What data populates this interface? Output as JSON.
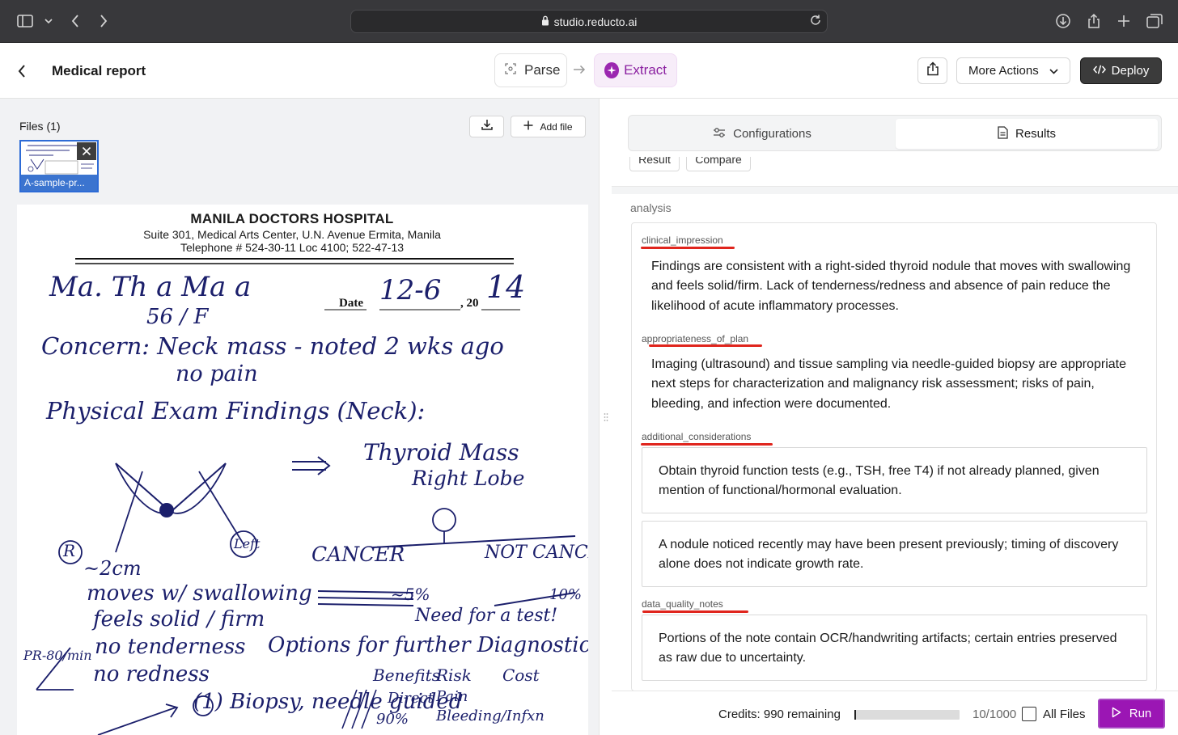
{
  "browser": {
    "url": "studio.reducto.ai"
  },
  "header": {
    "title": "Medical report",
    "steps": [
      "Parse",
      "Extract"
    ],
    "more_actions": "More Actions",
    "deploy": "Deploy"
  },
  "files": {
    "label": "Files (1)",
    "add_file": "Add file",
    "thumbnail_name": "A-sample-pr..."
  },
  "document": {
    "hospital_name": "MANILA DOCTORS HOSPITAL",
    "address": "Suite 301, Medical Arts Center, U.N. Avenue Ermita, Manila",
    "telephone": "Telephone # 524-30-11 Loc 4100; 522-47-13",
    "date_label": "Date",
    "date_year_prefix": ", 20",
    "handwriting": {
      "name": "Ma. Th   a Ma    a",
      "date": "12-6",
      "year": "14",
      "age_sex": "56 / F",
      "concern": "Concern: Neck mass - noted 2 wks ago",
      "no_pain": "no pain",
      "pe_heading": "Physical Exam Findings (Neck):",
      "thyroid": "Thyroid Mass",
      "right_lobe": "Right Lobe",
      "r": "R",
      "left": "Left",
      "cancer": "CANCER",
      "not_cancer": "NOT CANCER",
      "size": "~2cm",
      "moves": "moves w/ swallowing",
      "feels": "feels solid / firm",
      "pct_left": "~5%",
      "pct_right": "10%",
      "need": "Need for a test!",
      "no_tender": "no tenderness",
      "no_red": "no redness",
      "options": "Options for further Diagnostic Test:",
      "vitals": "PR-80/min",
      "benefits": "Benefits",
      "risk": "Risk",
      "cost": "Cost",
      "biopsy": "(1) Biopsy, needle guided",
      "direct": "Direct",
      "pct90": "90%",
      "pain": "Pain",
      "bleeding": "Bleeding/Infxn"
    }
  },
  "right": {
    "tabs": [
      "Configurations",
      "Results"
    ],
    "subtabs": [
      "Result",
      "Compare"
    ],
    "section_label": "analysis",
    "fields": {
      "clinical_impression": {
        "label": "clinical_impression",
        "text": "Findings are consistent with a right-sided thyroid nodule that moves with swallowing and feels solid/firm. Lack of tenderness/redness and absence of pain reduce the likelihood of acute inflammatory processes."
      },
      "appropriateness_of_plan": {
        "label": "appropriateness_of_plan",
        "text": "Imaging (ultrasound) and tissue sampling via needle-guided biopsy are appropriate next steps for characterization and malignancy risk assessment; risks of pain, bleeding, and infection were documented."
      },
      "additional_considerations": {
        "label": "additional_considerations",
        "items": [
          "Obtain thyroid function tests (e.g., TSH, free T4) if not already planned, given mention of functional/hormonal evaluation.",
          "A nodule noticed recently may have been present previously; timing of discovery alone does not indicate growth rate."
        ]
      },
      "data_quality_notes": {
        "label": "data_quality_notes",
        "items": [
          "Portions of the note contain OCR/handwriting artifacts; certain entries preserved as raw due to uncertainty."
        ]
      }
    }
  },
  "footer": {
    "credits": "Credits: 990 remaining",
    "usage_fraction": 0.01,
    "count": "10/1000",
    "all_files": "All Files",
    "run": "Run"
  },
  "colors": {
    "accent": "#9b16b4",
    "annotation_red": "#e0251d",
    "selection_blue": "#2d6bd6",
    "ink": "#1b1f6b"
  }
}
